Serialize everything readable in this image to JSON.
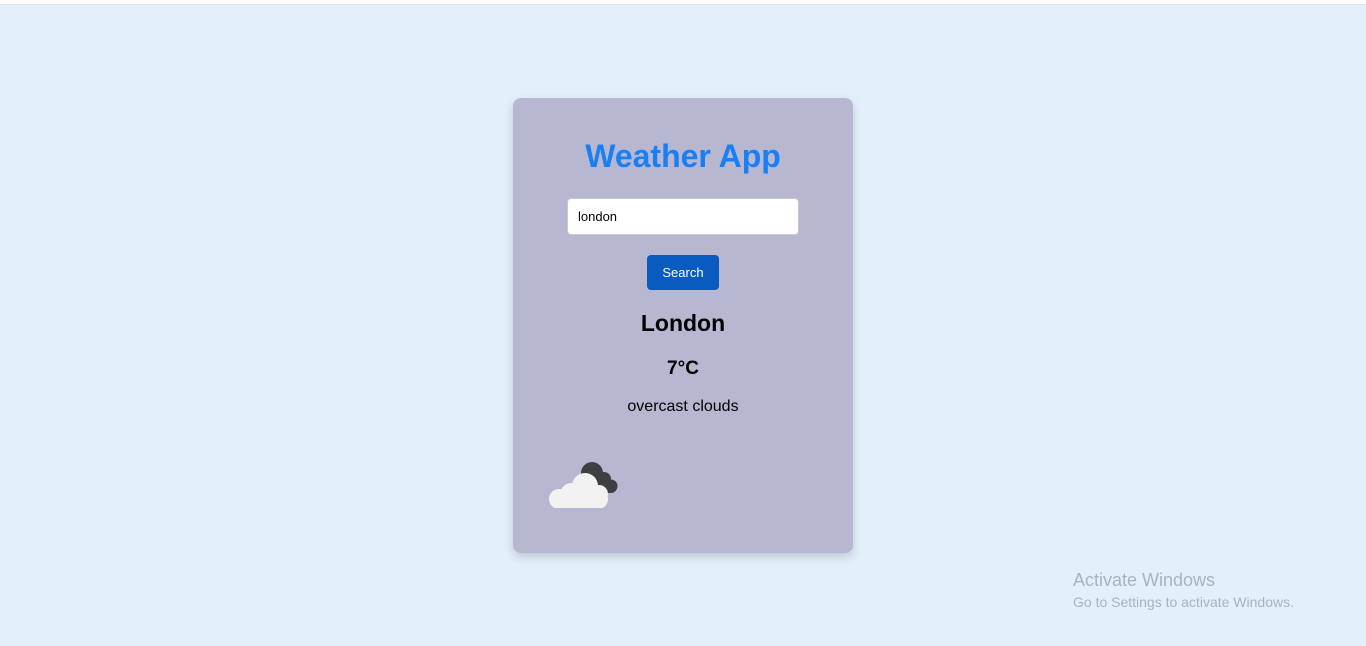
{
  "app": {
    "title": "Weather App"
  },
  "search": {
    "value": "london",
    "button_label": "Search"
  },
  "weather": {
    "city": "London",
    "temperature": "7°C",
    "description": "overcast clouds",
    "icon": "overcast-clouds-icon"
  },
  "watermark": {
    "title": "Activate Windows",
    "subtitle": "Go to Settings to activate Windows."
  },
  "colors": {
    "page_background": "#e3f0fb",
    "card_background": "#b7b7d1",
    "title": "#1a7ff5",
    "button": "#0a5bbf"
  }
}
